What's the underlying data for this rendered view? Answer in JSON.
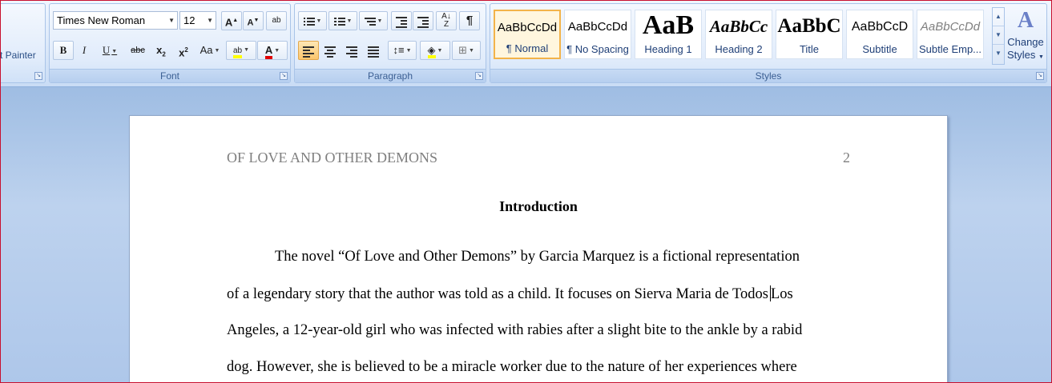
{
  "clipboard": {
    "format_painter_label": "t Painter"
  },
  "font_group": {
    "label": "Font",
    "font_name": "Times New Roman",
    "font_size": "12",
    "grow_label": "A",
    "shrink_label": "A",
    "clear_label": "ab",
    "bold_label": "B",
    "italic_label": "I",
    "underline_label": "U",
    "strike_label": "abc",
    "subscript_label": "x",
    "superscript_label": "x",
    "case_label": "Aa",
    "highlight_label": "ab",
    "font_color_label": "A",
    "highlight_color": "#ffff00",
    "font_color": "#e00000"
  },
  "paragraph_group": {
    "label": "Paragraph",
    "pilcrow": "¶"
  },
  "styles_group": {
    "label": "Styles",
    "tiles": [
      {
        "sample": "AaBbCcDd",
        "name": "¶ Normal"
      },
      {
        "sample": "AaBbCcDd",
        "name": "¶ No Spacing"
      },
      {
        "sample": "AaB",
        "name": "Heading 1"
      },
      {
        "sample": "AaBbCc",
        "name": "Heading 2"
      },
      {
        "sample": "AaBbC",
        "name": "Title"
      },
      {
        "sample": "AaBbCcD",
        "name": "Subtitle"
      },
      {
        "sample": "AaBbCcDd",
        "name": "Subtle Emp..."
      }
    ],
    "change_styles_line1": "Change",
    "change_styles_line2": "Styles"
  },
  "document": {
    "running_head": "OF LOVE AND OTHER DEMONS",
    "page_number": "2",
    "title": "Introduction",
    "lines": [
      "The novel “Of Love and Other Demons” by Garcia Marquez is a fictional representation",
      "of a legendary story that the author was told as a child. It focuses on Sierva Maria de Todos",
      "Los",
      "Angeles, a 12-year-old girl who was infected with rabies after a slight bite to the ankle by a rabid",
      "dog. However, she is believed to be a miracle worker due to the nature of her experiences where"
    ]
  }
}
